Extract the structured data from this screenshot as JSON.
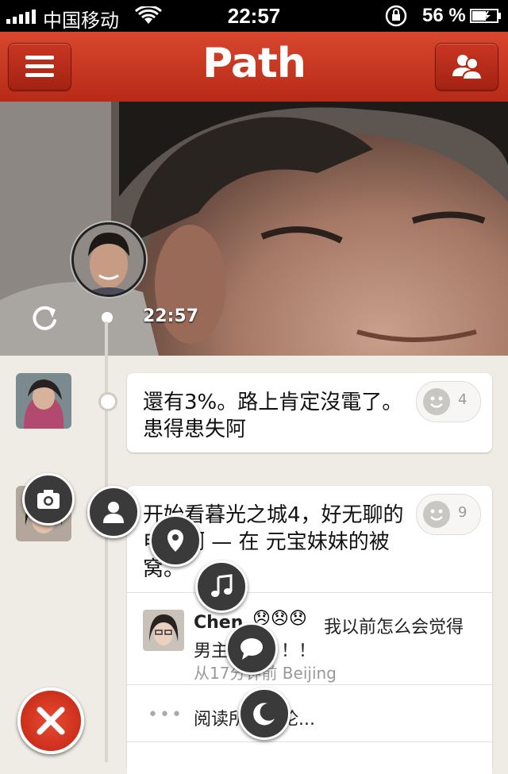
{
  "status_bar": {
    "carrier": "中国移动",
    "time": "22:57",
    "battery": "56 %"
  },
  "nav": {
    "logo": "Path",
    "menu_icon": "hamburger-icon",
    "friends_icon": "friends-icon"
  },
  "cover": {
    "time": "22:57",
    "refresh_icon": "refresh-icon"
  },
  "posts": [
    {
      "text": "還有3%。路上肯定沒電了。患得患失阿",
      "smile_count": "4"
    },
    {
      "text": "开始看暮光之城4，好无聊的电影啊 — 在 元宝妹妹的被窝。",
      "smile_count": "9",
      "comment": {
        "name": "Chen",
        "emoji": "😞😞😞",
        "text_line1": "我以前怎么会觉得",
        "text_line2": "男主很帅！！！",
        "meta": "从17分钟前 Beijing"
      },
      "read_more": "阅读所有评论..."
    }
  ],
  "fab_menu": [
    "camera-icon",
    "person-icon",
    "location-icon",
    "music-icon",
    "chat-icon",
    "moon-icon"
  ],
  "colors": {
    "brand": "#c83520",
    "close": "#d93b25"
  }
}
